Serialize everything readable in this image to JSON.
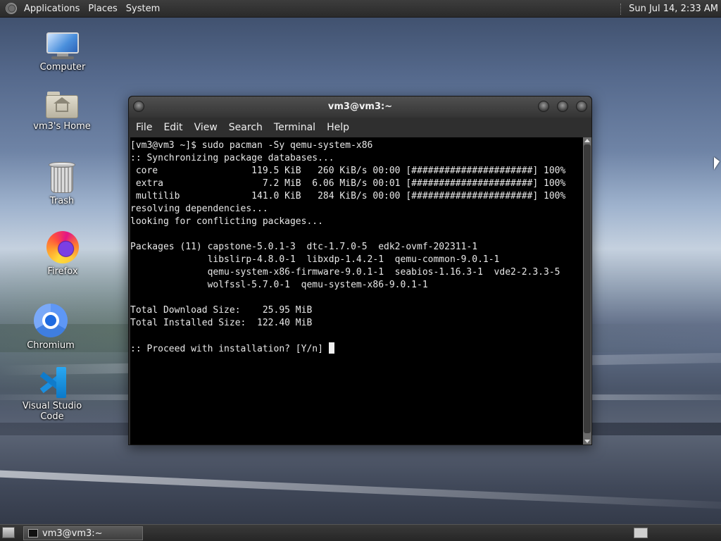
{
  "top_panel": {
    "applications": "Applications",
    "places": "Places",
    "system": "System",
    "clock": "Sun Jul 14,  2:33 AM"
  },
  "desktop_icons": {
    "computer": "Computer",
    "home": "vm3's Home",
    "trash": "Trash",
    "firefox": "Firefox",
    "chromium": "Chromium",
    "vscode": "Visual Studio Code"
  },
  "terminal": {
    "title": "vm3@vm3:~",
    "menu": [
      "File",
      "Edit",
      "View",
      "Search",
      "Terminal",
      "Help"
    ],
    "lines": [
      "[vm3@vm3 ~]$ sudo pacman -Sy qemu-system-x86",
      ":: Synchronizing package databases...",
      " core                 119.5 KiB   260 KiB/s 00:00 [######################] 100%",
      " extra                  7.2 MiB  6.06 MiB/s 00:01 [######################] 100%",
      " multilib             141.0 KiB   284 KiB/s 00:00 [######################] 100%",
      "resolving dependencies...",
      "looking for conflicting packages...",
      "",
      "Packages (11) capstone-5.0.1-3  dtc-1.7.0-5  edk2-ovmf-202311-1",
      "              libslirp-4.8.0-1  libxdp-1.4.2-1  qemu-common-9.0.1-1",
      "              qemu-system-x86-firmware-9.0.1-1  seabios-1.16.3-1  vde2-2.3.3-5",
      "              wolfssl-5.7.0-1  qemu-system-x86-9.0.1-1",
      "",
      "Total Download Size:    25.95 MiB",
      "Total Installed Size:  122.40 MiB",
      "",
      ":: Proceed with installation? [Y/n] "
    ]
  },
  "taskbar": {
    "task_label": "vm3@vm3:~"
  }
}
